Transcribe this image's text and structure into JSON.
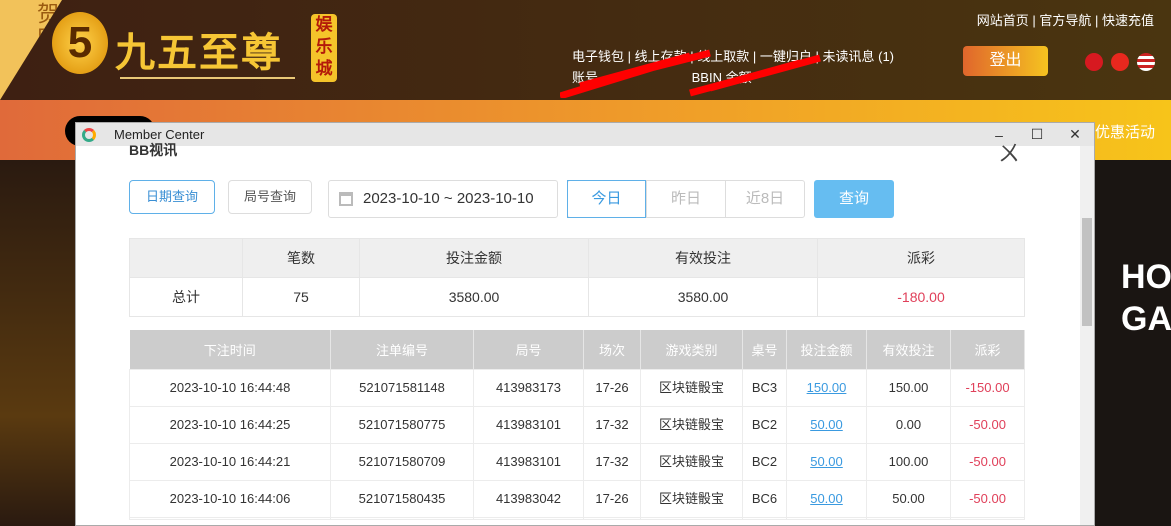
{
  "header": {
    "festival": "贺中秋",
    "logo_digit": "5",
    "logo_name": "九五至尊",
    "logo_tag": "娱乐城",
    "top_links": [
      "网站首页",
      "官方导航",
      "快速充值"
    ],
    "user_links": [
      "电子钱包",
      "线上存款",
      "线上取款",
      "一键归户",
      "未读讯息 (1)"
    ],
    "account_label": "账号",
    "balance_label": "BBIN 余额",
    "logout": "登出",
    "promo": "优惠活动"
  },
  "hero": {
    "text": "HO GA"
  },
  "window": {
    "title": "Member Center",
    "minimize": "–",
    "maximize": "☐",
    "close": "✕"
  },
  "panel": {
    "title": "BB视讯",
    "close": "ㄨ",
    "tab_date": "日期查询",
    "tab_round": "局号查询",
    "date_range": "2023-10-10 ~ 2023-10-10",
    "quick": [
      "今日",
      "昨日",
      "近8日"
    ],
    "query": "查询"
  },
  "summary": {
    "headers": [
      "",
      "笔数",
      "投注金额",
      "有效投注",
      "派彩"
    ],
    "row": [
      "总计",
      "75",
      "3580.00",
      "3580.00",
      "-180.00"
    ]
  },
  "details": {
    "headers": [
      "下注时间",
      "注单编号",
      "局号",
      "场次",
      "游戏类别",
      "桌号",
      "投注金额",
      "有效投注",
      "派彩"
    ],
    "rows": [
      [
        "2023-10-10 16:44:48",
        "521071581148",
        "413983173",
        "17-26",
        "区块链骰宝",
        "BC3",
        "150.00",
        "150.00",
        "-150.00"
      ],
      [
        "2023-10-10 16:44:25",
        "521071580775",
        "413983101",
        "17-32",
        "区块链骰宝",
        "BC2",
        "50.00",
        "0.00",
        "-50.00"
      ],
      [
        "2023-10-10 16:44:21",
        "521071580709",
        "413983101",
        "17-32",
        "区块链骰宝",
        "BC2",
        "50.00",
        "100.00",
        "-50.00"
      ],
      [
        "2023-10-10 16:44:06",
        "521071580435",
        "413983042",
        "17-26",
        "区块链骰宝",
        "BC6",
        "50.00",
        "50.00",
        "-50.00"
      ],
      [
        "",
        "",
        "",
        "",
        "",
        "",
        "",
        "",
        ""
      ]
    ]
  }
}
